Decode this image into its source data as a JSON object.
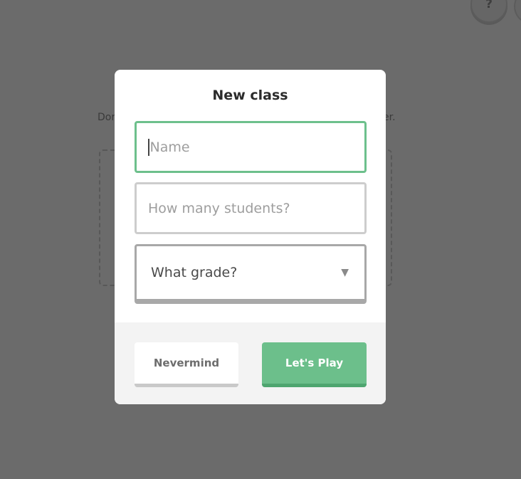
{
  "background": {
    "text_left": "Dor",
    "text_right": "er.",
    "help_label": "?"
  },
  "modal": {
    "title": "New class",
    "name_placeholder": "Name",
    "students_placeholder": "How many students?",
    "grade_select": {
      "selected": "What grade?",
      "arrow": "▼"
    },
    "cancel_label": "Nevermind",
    "submit_label": "Let's Play"
  },
  "colors": {
    "accent": "#6cbf8b",
    "accent_shadow": "#4ea56f",
    "overlay": "#6b6b6b"
  }
}
